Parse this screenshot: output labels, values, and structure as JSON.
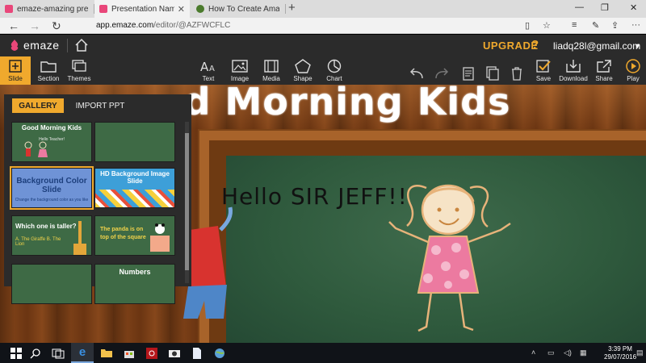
{
  "browser": {
    "tabs": [
      {
        "label": "emaze-amazing presentation",
        "active": false,
        "favicon_color": "#e9477a"
      },
      {
        "label": "Presentation Name by li",
        "active": true,
        "favicon_color": "#e9477a"
      },
      {
        "label": "How To Create Amazing Pre",
        "active": false,
        "favicon_color": "#4b7b2d"
      }
    ],
    "new_tab": "+",
    "url_host": "app.emaze.com",
    "url_path": "/editor/@AZFWCFLC"
  },
  "app": {
    "logo": "emaze",
    "upgrade": "UPGRADE",
    "help": "?",
    "user_email": "liadq28l@gmail.com",
    "accent": "#f0a92d"
  },
  "toolbar": {
    "slide": "Slide",
    "section": "Section",
    "themes": "Themes",
    "text": "Text",
    "image": "Image",
    "media": "Media",
    "shape": "Shape",
    "chart": "Chart",
    "save": "Save",
    "download": "Download",
    "share": "Share",
    "play": "Play"
  },
  "panel": {
    "gallery_tab": "GALLERY",
    "import_tab": "IMPORT PPT",
    "thumbnails": [
      {
        "title": "Good Morning Kids",
        "sub": "Hello Teacher!"
      },
      {
        "title": "",
        "sub": ""
      },
      {
        "title": "Background Color Slide",
        "sub": "Change the background color as you like"
      },
      {
        "title": "HD Background Image Slide",
        "sub": ""
      },
      {
        "title": "Which one is taller?",
        "sub": "A. The Giraffe  B. The Lion"
      },
      {
        "title": "The panda is on top of the square",
        "sub": ""
      },
      {
        "title": "",
        "sub": ""
      },
      {
        "title": "Numbers",
        "sub": ""
      }
    ]
  },
  "slide": {
    "title": "d Morning Kids",
    "board_text": "Hello SIR JEFF!!"
  },
  "taskbar": {
    "time": "3:39 PM",
    "date": "29/07/2016"
  }
}
